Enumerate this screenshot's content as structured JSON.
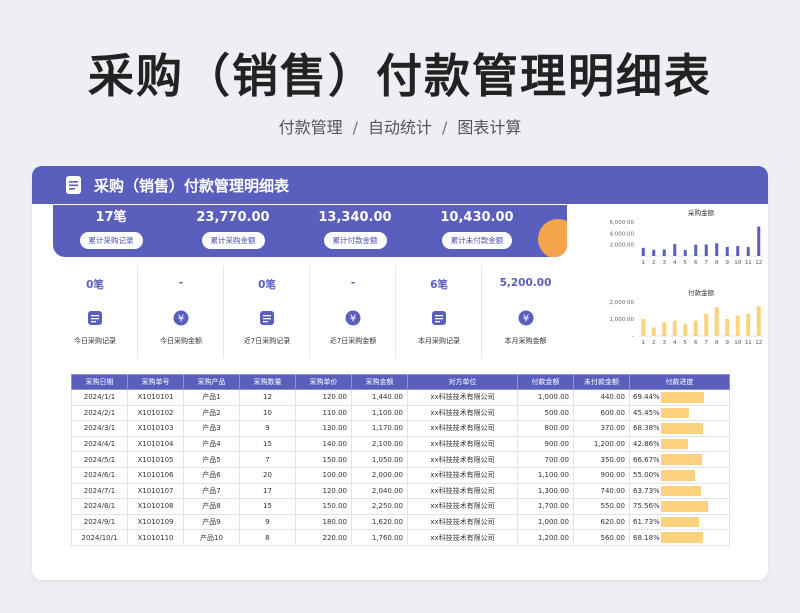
{
  "title": "采购（销售）付款管理明细表",
  "subtitle": {
    "part1": "付款管理",
    "separator": "/",
    "part2": "自动统计",
    "part3": "图表计算"
  },
  "card": {
    "title": "采购（销售）付款管理明细表",
    "icon": "document-icon",
    "kpis": [
      {
        "value": "17笔",
        "label": "累计采购记录"
      },
      {
        "value": "23,770.00",
        "label": "累计采购金额"
      },
      {
        "value": "13,340.00",
        "label": "累计付款金额"
      },
      {
        "value": "10,430.00",
        "label": "累计未付款金额"
      }
    ],
    "stats": [
      {
        "value": "0笔",
        "icon": "document-icon",
        "label": "今日采购记录"
      },
      {
        "value": "-",
        "icon": "yuan-icon",
        "label": "今日采购金额"
      },
      {
        "value": "0笔",
        "icon": "document-icon",
        "label": "近7日采购记录"
      },
      {
        "value": "-",
        "icon": "yuan-icon",
        "label": "近7日采购金额"
      },
      {
        "value": "6笔",
        "icon": "document-icon",
        "label": "本月采购记录"
      },
      {
        "value": "5,200.00",
        "icon": "yuan-icon",
        "label": "本月采购金额"
      }
    ]
  },
  "chart_data": [
    {
      "type": "bar",
      "title": "采购金额",
      "categories": [
        "1",
        "2",
        "3",
        "4",
        "5",
        "6",
        "7",
        "8",
        "9",
        "10",
        "11",
        "12"
      ],
      "values": [
        1440,
        1100,
        1170,
        2100,
        1050,
        2000,
        2040,
        2250,
        1620,
        1760,
        1600,
        5200
      ],
      "ylim": [
        0,
        6000
      ],
      "yticks": [
        "2,000.00",
        "4,000.00",
        "6,000.00"
      ],
      "color": "#5a5fbe",
      "grid": false
    },
    {
      "type": "bar",
      "title": "付款金额",
      "categories": [
        "1",
        "2",
        "3",
        "4",
        "5",
        "6",
        "7",
        "8",
        "9",
        "10",
        "11",
        "12"
      ],
      "values": [
        1000,
        500,
        800,
        900,
        700,
        900,
        1300,
        1700,
        1000,
        1200,
        1300,
        1750
      ],
      "ylim": [
        0,
        2000
      ],
      "yticks": [
        "-",
        "1,000.00",
        "2,000.00"
      ],
      "color": "#fdd27e",
      "grid": false
    }
  ],
  "table": {
    "headers": [
      "采购日期",
      "采购单号",
      "采购产品",
      "采购数量",
      "采购单价",
      "采购金额",
      "对方单位",
      "付款金额",
      "未付款金额",
      "付款进度"
    ],
    "rows": [
      [
        "2024/1/1",
        "X1010101",
        "产品1",
        "12",
        "120.00",
        "1,440.00",
        "xx科技技术有限公司",
        "1,000.00",
        "440.00",
        "69.44%"
      ],
      [
        "2024/2/1",
        "X1010102",
        "产品2",
        "10",
        "110.00",
        "1,100.00",
        "xx科技技术有限公司",
        "500.00",
        "600.00",
        "45.45%"
      ],
      [
        "2024/3/1",
        "X1010103",
        "产品3",
        "9",
        "130.00",
        "1,170.00",
        "xx科技技术有限公司",
        "800.00",
        "370.00",
        "68.38%"
      ],
      [
        "2024/4/1",
        "X1010104",
        "产品4",
        "15",
        "140.00",
        "2,100.00",
        "xx科技技术有限公司",
        "900.00",
        "1,200.00",
        "42.86%"
      ],
      [
        "2024/5/1",
        "X1010105",
        "产品5",
        "7",
        "150.00",
        "1,050.00",
        "xx科技技术有限公司",
        "700.00",
        "350.00",
        "66.67%"
      ],
      [
        "2024/6/1",
        "X1010106",
        "产品6",
        "20",
        "100.00",
        "2,000.00",
        "xx科技技术有限公司",
        "1,100.00",
        "900.00",
        "55.00%"
      ],
      [
        "2024/7/1",
        "X1010107",
        "产品7",
        "17",
        "120.00",
        "2,040.00",
        "xx科技技术有限公司",
        "1,300.00",
        "740.00",
        "63.73%"
      ],
      [
        "2024/8/1",
        "X1010108",
        "产品8",
        "15",
        "150.00",
        "2,250.00",
        "xx科技技术有限公司",
        "1,700.00",
        "550.00",
        "75.56%"
      ],
      [
        "2024/9/1",
        "X1010109",
        "产品9",
        "9",
        "180.00",
        "1,620.00",
        "xx科技技术有限公司",
        "1,000.00",
        "620.00",
        "61.73%"
      ],
      [
        "2024/10/1",
        "X1010110",
        "产品10",
        "8",
        "220.00",
        "1,760.00",
        "xx科技技术有限公司",
        "1,200.00",
        "560.00",
        "68.18%"
      ]
    ],
    "progress": [
      0.6944,
      0.4545,
      0.6838,
      0.4286,
      0.6667,
      0.55,
      0.6373,
      0.7556,
      0.6173,
      0.6818
    ]
  }
}
